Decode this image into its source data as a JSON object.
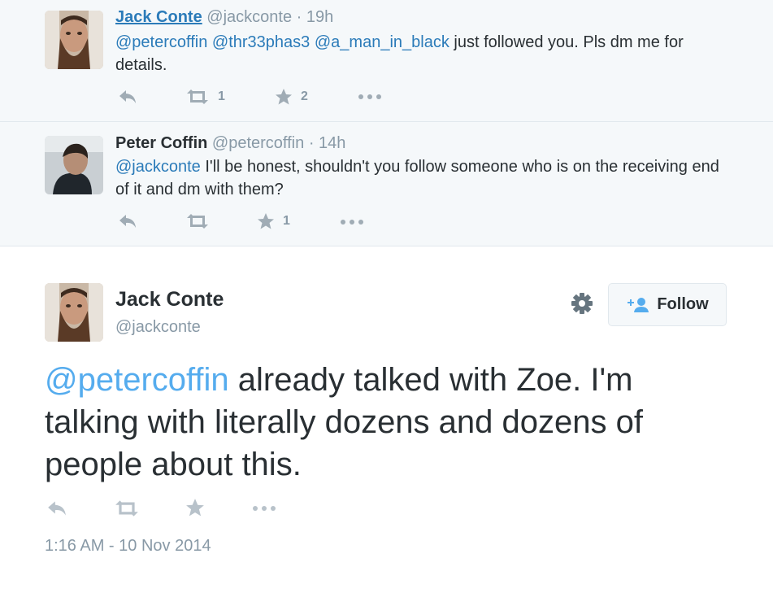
{
  "replies": [
    {
      "name": "Jack Conte",
      "handle": "@jackconte",
      "sep": "·",
      "time": "19h",
      "mentions": [
        "@petercoffin",
        "@thr33phas3",
        "@a_man_in_black"
      ],
      "text_after": "just followed you. Pls dm me for details.",
      "retweet_count": "1",
      "favorite_count": "2"
    },
    {
      "name": "Peter Coffin",
      "handle": "@petercoffin",
      "sep": "·",
      "time": "14h",
      "mention": "@jackconte",
      "text_after": "I'll be honest, shouldn't you follow someone who is on the receiving end of it and dm with them?",
      "favorite_count": "1"
    }
  ],
  "main_tweet": {
    "name": "Jack Conte",
    "handle": "@jackconte",
    "follow_label": "Follow",
    "mention": "@petercoffin",
    "text_after": "already talked with Zoe. I'm talking with literally dozens and dozens of people about this.",
    "timestamp": "1:16 AM - 10 Nov 2014"
  },
  "icons": {
    "reply": "reply-icon",
    "retweet": "retweet-icon",
    "favorite": "star-icon",
    "more": "more-dots-icon",
    "settings": "gear-icon",
    "follow": "add-user-icon"
  },
  "colors": {
    "link": "#2b7bb9",
    "muted": "#8899a6",
    "text": "#292f33",
    "reply_bg": "#f5f8fa"
  }
}
